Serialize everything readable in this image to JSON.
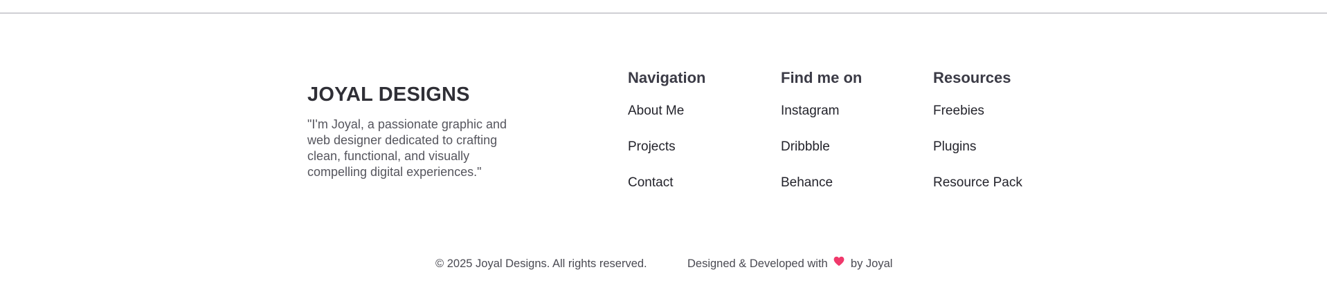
{
  "brand": {
    "title": "JOYAL DESIGNS",
    "quote": "\"I'm Joyal, a passionate graphic and web designer dedicated to crafting clean, functional, and visually compelling digital experiences.\""
  },
  "columns": [
    {
      "heading": "Navigation",
      "links": [
        "About Me",
        "Projects",
        "Contact"
      ]
    },
    {
      "heading": "Find me on",
      "links": [
        "Instagram",
        "Dribbble",
        "Behance"
      ]
    },
    {
      "heading": "Resources",
      "links": [
        "Freebies",
        "Plugins",
        "Resource Pack"
      ]
    }
  ],
  "footer": {
    "copyright": "© 2025 Joyal Designs. All rights reserved.",
    "credit_prefix": "Designed & Developed with",
    "credit_suffix": "by Joyal",
    "heart_icon": "heart-icon",
    "heart_color": "#f0386b"
  }
}
